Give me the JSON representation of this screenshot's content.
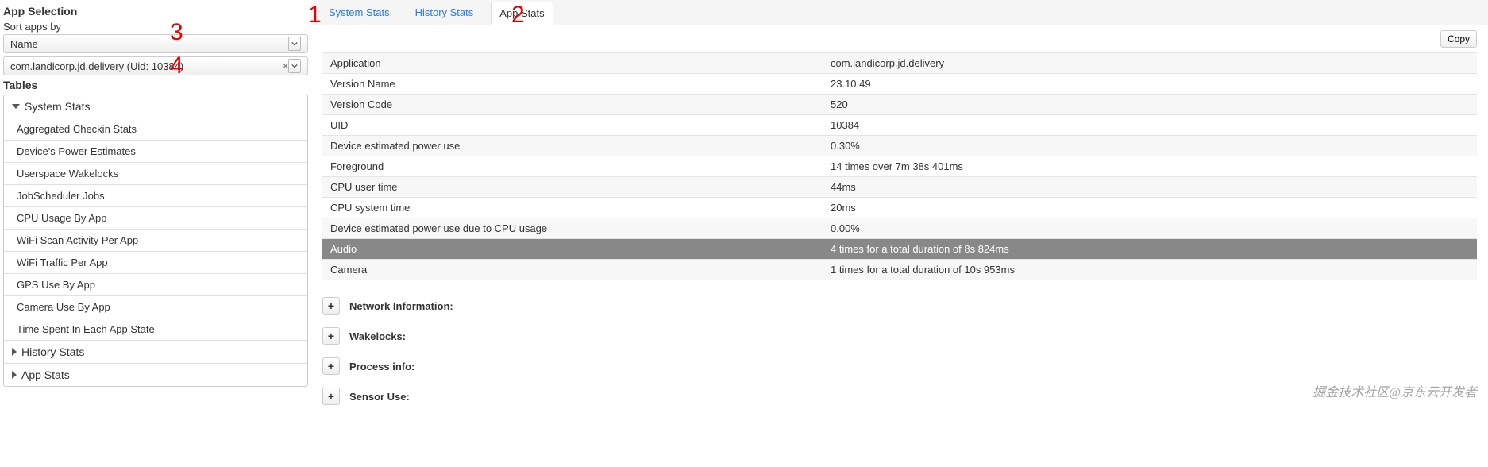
{
  "sidebar": {
    "heading": "App Selection",
    "sort_label": "Sort apps by",
    "sort_value": "Name",
    "app_value": "com.landicorp.jd.delivery (Uid: 10384)",
    "tables_heading": "Tables",
    "tree": {
      "system_stats": {
        "label": "System Stats",
        "items": [
          "Aggregated Checkin Stats",
          "Device's Power Estimates",
          "Userspace Wakelocks",
          "JobScheduler Jobs",
          "CPU Usage By App",
          "WiFi Scan Activity Per App",
          "WiFi Traffic Per App",
          "GPS Use By App",
          "Camera Use By App",
          "Time Spent In Each App State"
        ]
      },
      "history_stats": {
        "label": "History Stats"
      },
      "app_stats": {
        "label": "App Stats"
      }
    }
  },
  "tabs": {
    "system": "System Stats",
    "history": "History Stats",
    "app": "App Stats"
  },
  "copy_label": "Copy",
  "app_table": [
    {
      "k": "Application",
      "v": "com.landicorp.jd.delivery"
    },
    {
      "k": "Version Name",
      "v": "23.10.49"
    },
    {
      "k": "Version Code",
      "v": "520"
    },
    {
      "k": "UID",
      "v": "10384"
    },
    {
      "k": "Device estimated power use",
      "v": "0.30%"
    },
    {
      "k": "Foreground",
      "v": "14 times over 7m 38s 401ms"
    },
    {
      "k": "CPU user time",
      "v": "44ms"
    },
    {
      "k": "CPU system time",
      "v": "20ms"
    },
    {
      "k": "Device estimated power use due to CPU usage",
      "v": "0.00%"
    },
    {
      "k": "Audio",
      "v": "4 times for a total duration of 8s 824ms",
      "selected": true
    },
    {
      "k": "Camera",
      "v": "1 times for a total duration of 10s 953ms"
    }
  ],
  "accordions": [
    "Network Information:",
    "Wakelocks:",
    "Process info:",
    "Sensor Use:"
  ],
  "annotations": {
    "a1": "1",
    "a2": "2",
    "a3": "3",
    "a4": "4"
  },
  "watermark": "掘金技术社区@京东云开发者"
}
